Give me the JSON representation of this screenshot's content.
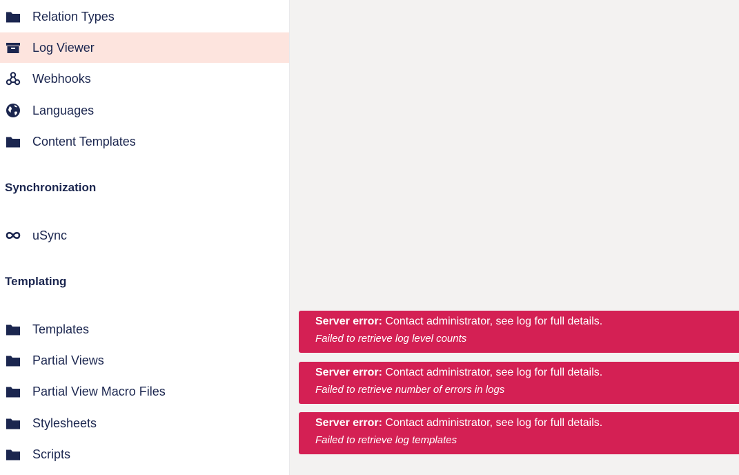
{
  "sidebar": {
    "items_top": [
      {
        "label": "Relation Types",
        "icon": "folder-icon"
      },
      {
        "label": "Log Viewer",
        "icon": "archive-icon",
        "active": true
      },
      {
        "label": "Webhooks",
        "icon": "webhook-icon"
      },
      {
        "label": "Languages",
        "icon": "globe-icon"
      },
      {
        "label": "Content Templates",
        "icon": "folder-icon"
      }
    ],
    "section_sync": "Synchronization",
    "usync": {
      "label": "uSync",
      "icon": "infinity-icon"
    },
    "section_templating": "Templating",
    "items_templating": [
      {
        "label": "Templates",
        "icon": "folder-icon"
      },
      {
        "label": "Partial Views",
        "icon": "folder-icon"
      },
      {
        "label": "Partial View Macro Files",
        "icon": "folder-icon"
      },
      {
        "label": "Stylesheets",
        "icon": "folder-icon"
      },
      {
        "label": "Scripts",
        "icon": "folder-icon"
      }
    ]
  },
  "notifications": [
    {
      "heading": "Server error:",
      "message": "Contact administrator, see log for full details.",
      "detail": "Failed to retrieve log level counts"
    },
    {
      "heading": "Server error:",
      "message": "Contact administrator, see log for full details.",
      "detail": "Failed to retrieve number of errors in logs"
    },
    {
      "heading": "Server error:",
      "message": "Contact administrator, see log for full details.",
      "detail": "Failed to retrieve log templates"
    }
  ],
  "colors": {
    "sidebar_bg": "#ffffff",
    "content_bg": "#f3f2f1",
    "active_bg": "#fde4de",
    "text": "#1b264f",
    "error_bg": "#d42054"
  }
}
